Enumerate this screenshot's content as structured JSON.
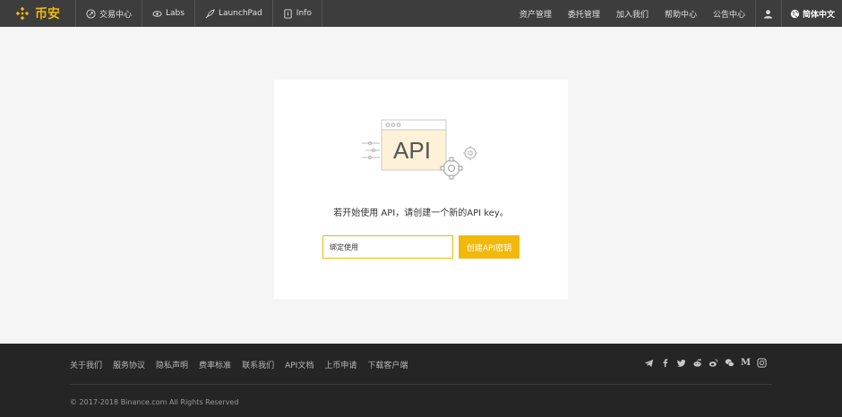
{
  "brand": {
    "name": "币安",
    "color": "#f0b90b"
  },
  "nav": {
    "left": [
      {
        "label": "交易中心",
        "icon": "exchange-icon"
      },
      {
        "label": "Labs",
        "icon": "labs-eye-icon"
      },
      {
        "label": "LaunchPad",
        "icon": "rocket-icon"
      },
      {
        "label": "Info",
        "icon": "info-doc-icon"
      }
    ],
    "right": [
      "资产管理",
      "委托管理",
      "加入我们",
      "帮助中心",
      "公告中心"
    ],
    "user_icon": "user-icon",
    "language": "简体中文"
  },
  "main": {
    "illustration_text": "API",
    "message": "若开始使用 API，请创建一个新的API key。",
    "input_value": "绑定使用",
    "create_button": "创建API密钥"
  },
  "footer": {
    "links": [
      "关于我们",
      "服务协议",
      "隐私声明",
      "费率标准",
      "联系我们",
      "API文档",
      "上币申请",
      "下载客户端"
    ],
    "socials": [
      "telegram-icon",
      "facebook-icon",
      "twitter-icon",
      "reddit-icon",
      "weibo-icon",
      "wechat-icon",
      "medium-icon",
      "instagram-icon"
    ],
    "medium_letter": "M",
    "copyright": "© 2017-2018 Binance.com All Rights Reserved"
  },
  "colors": {
    "accent": "#f0b90b",
    "topbar": "#3d3d3d",
    "footer": "#252525",
    "background": "#f5f5f5"
  }
}
